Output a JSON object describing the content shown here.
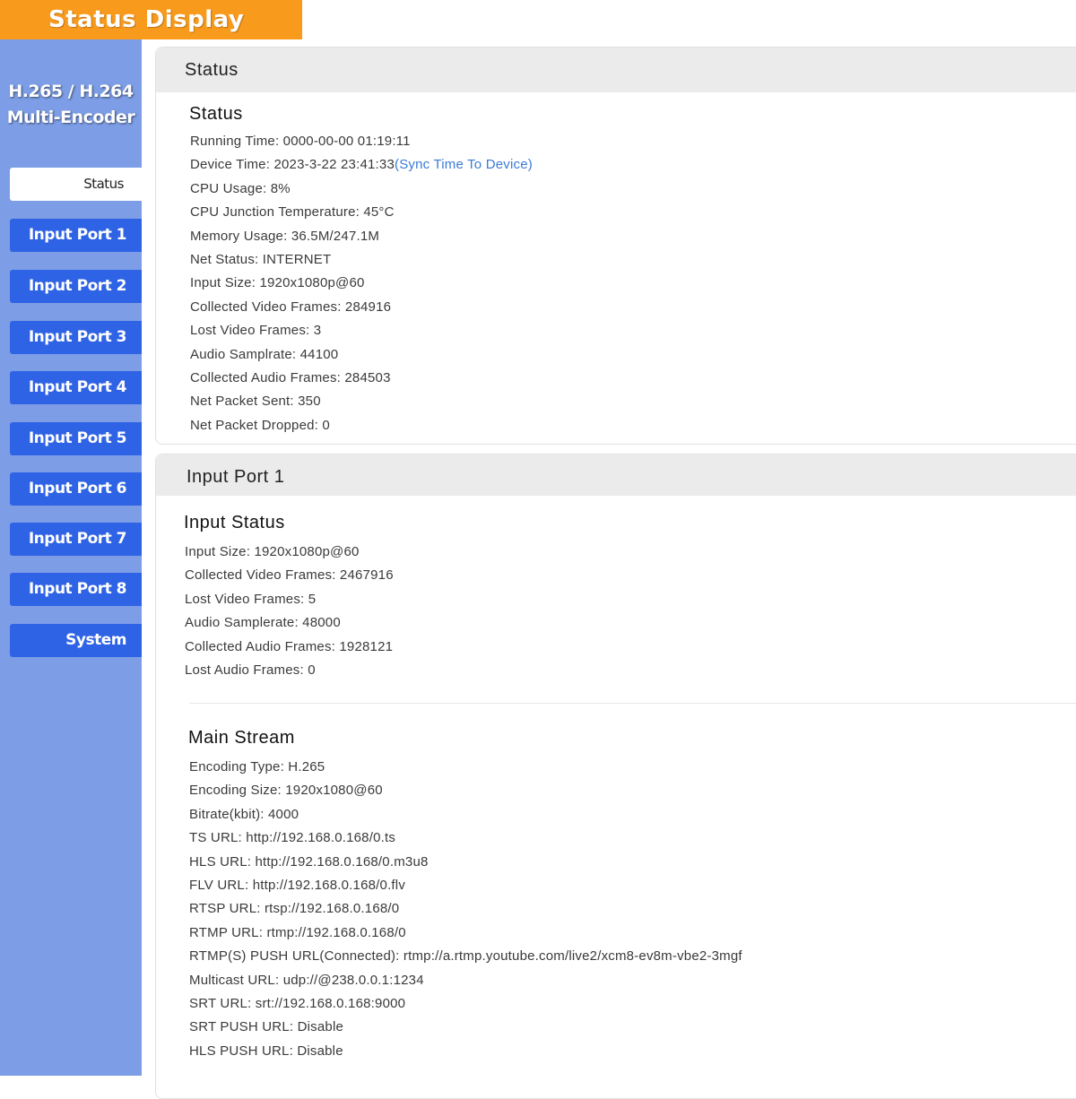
{
  "banner": {
    "title": "Status Display"
  },
  "sidebar": {
    "title_line1": "H.265 / H.264",
    "title_line2": "Multi-Encoder",
    "items": [
      {
        "label": "Status"
      },
      {
        "label": "Input Port 1"
      },
      {
        "label": "Input Port 2"
      },
      {
        "label": "Input Port 3"
      },
      {
        "label": "Input Port 4"
      },
      {
        "label": "Input Port 5"
      },
      {
        "label": "Input Port 6"
      },
      {
        "label": "Input Port 7"
      },
      {
        "label": "Input Port 8"
      },
      {
        "label": "System"
      }
    ]
  },
  "status_panel": {
    "header": "Status",
    "section_title": "Status",
    "running_time": "Running Time: 0000-00-00 01:19:11",
    "device_time": "Device Time: 2023-3-22 23:41:33",
    "sync_link": "(Sync Time To Device)",
    "cpu_usage": "CPU Usage: 8%",
    "cpu_temp": "CPU Junction Temperature: 45°C",
    "memory_usage": "Memory Usage: 36.5M/247.1M",
    "net_status": "Net Status: INTERNET",
    "input_size": "Input Size: 1920x1080p@60",
    "collected_video": "Collected Video Frames: 284916",
    "lost_video": "Lost Video Frames: 3",
    "audio_samplerate": "Audio Samplrate: 44100",
    "collected_audio": "Collected Audio Frames: 284503",
    "net_packet_sent": "Net Packet Sent: 350",
    "net_packet_dropped": "Net Packet Dropped: 0"
  },
  "input_port_panel": {
    "header": "Input Port 1",
    "input_status_title": "Input Status",
    "input_size": "Input Size: 1920x1080p@60",
    "collected_video": "Collected Video Frames: 2467916",
    "lost_video": "Lost Video Frames: 5",
    "audio_samplerate": "Audio Samplerate: 48000",
    "collected_audio": "Collected Audio Frames: 1928121",
    "lost_audio": "Lost Audio Frames: 0",
    "main_stream_title": "Main Stream",
    "encoding_type": "Encoding Type: H.265",
    "encoding_size": "Encoding Size: 1920x1080@60",
    "bitrate": "Bitrate(kbit): 4000",
    "ts_url": "TS URL: http://192.168.0.168/0.ts",
    "hls_url": "HLS URL: http://192.168.0.168/0.m3u8",
    "flv_url": "FLV URL: http://192.168.0.168/0.flv",
    "rtsp_url": "RTSP URL: rtsp://192.168.0.168/0",
    "rtmp_url": "RTMP URL: rtmp://192.168.0.168/0",
    "rtmps_push_url": "RTMP(S) PUSH URL(Connected): rtmp://a.rtmp.youtube.com/live2/xcm8-ev8m-vbe2-3mgf",
    "multicast_url": "Multicast URL: udp://@238.0.0.1:1234",
    "srt_url": "SRT URL: srt://192.168.0.168:9000",
    "srt_push_url": "SRT PUSH URL: Disable",
    "hls_push_url": "HLS PUSH URL: Disable"
  }
}
